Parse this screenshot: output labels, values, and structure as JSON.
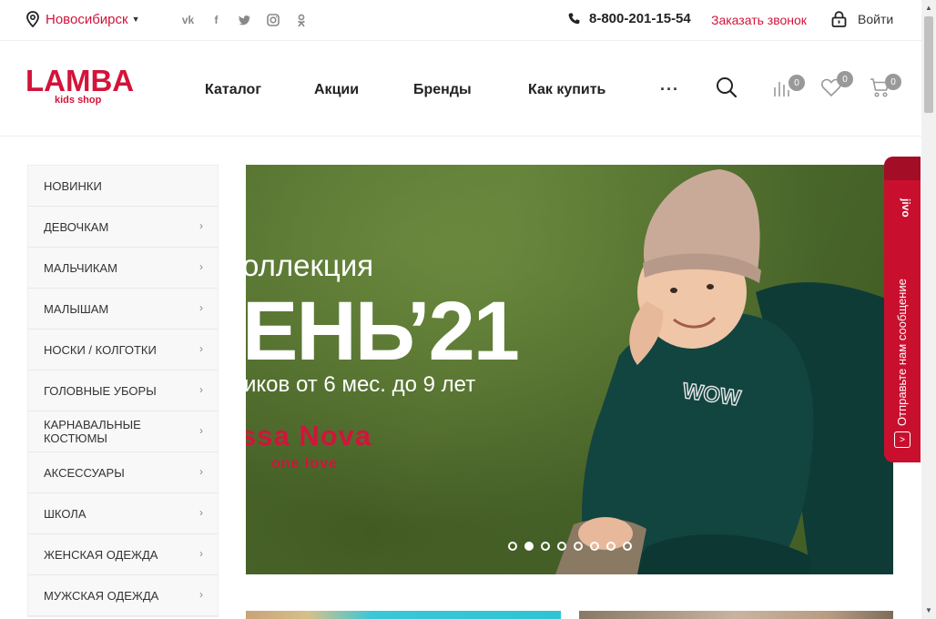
{
  "topbar": {
    "city": "Новосибирск",
    "socials": [
      "vk-icon",
      "facebook-icon",
      "twitter-icon",
      "instagram-icon",
      "odnoklassniki-icon"
    ],
    "phone": "8-800-201-15-54",
    "callback": "Заказать звонок",
    "login": "Войти"
  },
  "header": {
    "logo_main": "LAMBA",
    "logo_sub": "kids shop",
    "nav": [
      "Каталог",
      "Акции",
      "Бренды",
      "Как купить"
    ],
    "more": "···",
    "compare_count": "0",
    "favorites_count": "0",
    "cart_count": "0"
  },
  "sidebar": {
    "items": [
      {
        "label": "НОВИНКИ",
        "arrow": false
      },
      {
        "label": "ДЕВОЧКАМ",
        "arrow": true
      },
      {
        "label": "МАЛЬЧИКАМ",
        "arrow": true
      },
      {
        "label": "МАЛЫШАМ",
        "arrow": true
      },
      {
        "label": "НОСКИ / КОЛГОТКИ",
        "arrow": true
      },
      {
        "label": "ГОЛОВНЫЕ УБОРЫ",
        "arrow": true
      },
      {
        "label": "КАРНАВАЛЬНЫЕ КОСТЮМЫ",
        "arrow": true
      },
      {
        "label": "АКСЕССУАРЫ",
        "arrow": true
      },
      {
        "label": "ШКОЛА",
        "arrow": true
      },
      {
        "label": "ЖЕНСКАЯ ОДЕЖДА",
        "arrow": true
      },
      {
        "label": "МУЖСКАЯ ОДЕЖДА",
        "arrow": true
      }
    ]
  },
  "banner": {
    "line1": "оллекция",
    "line2": "ЕНЬ’21",
    "line3": "иков от 6 мес. до 9 лет",
    "brand": "ssa Nova",
    "slogan": "one love",
    "hoodie_print": "WOW",
    "slides": 8,
    "active_slide": 2
  },
  "jivo": {
    "logo": "jivo",
    "text": "Отправьте нам сообщение"
  },
  "colors": {
    "brand": "#d2143a",
    "jivo": "#c8102e",
    "badge": "#999999"
  }
}
